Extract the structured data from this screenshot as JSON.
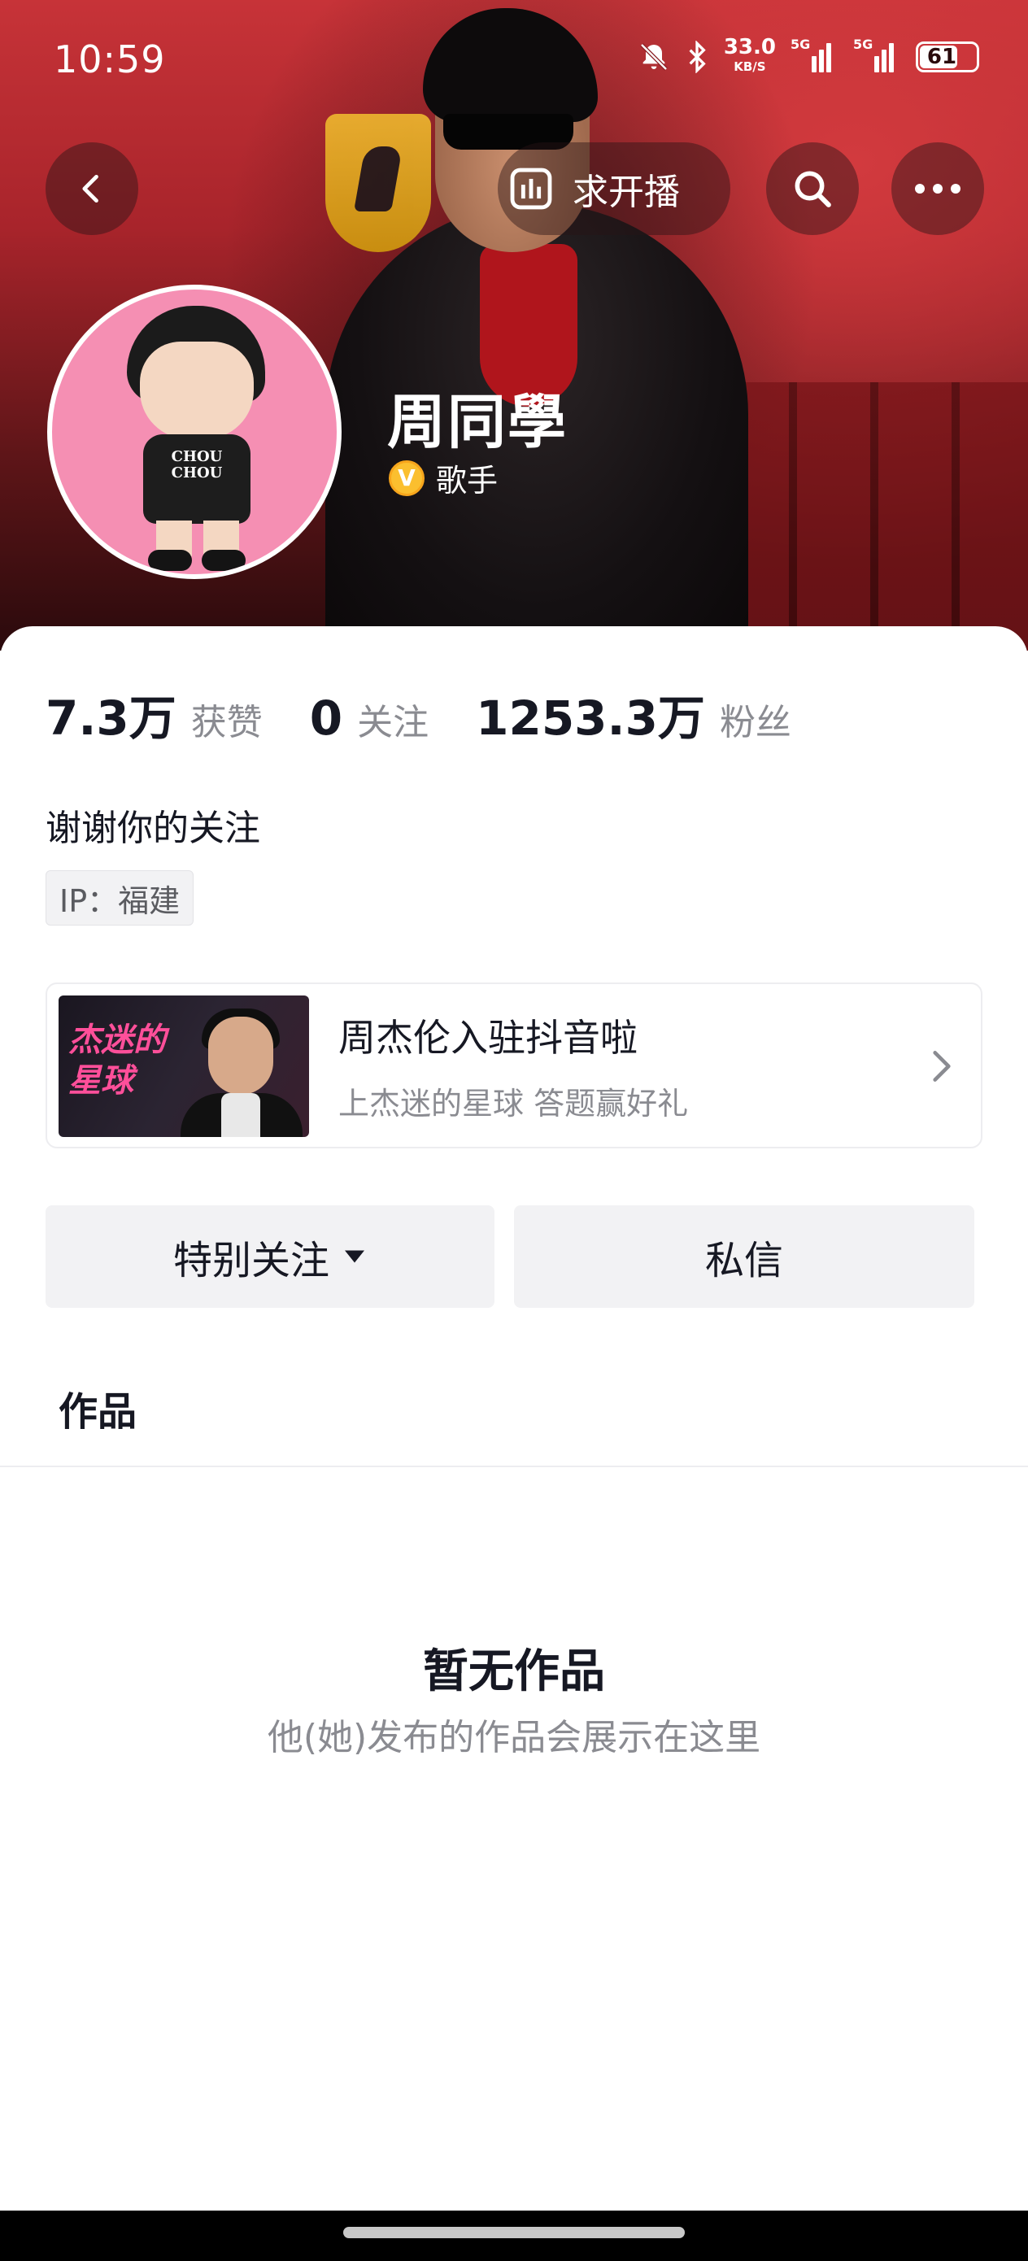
{
  "status_bar": {
    "time": "10:59",
    "speed_value": "33.0",
    "speed_unit": "KB/S",
    "network_1": "5G",
    "network_2": "5G",
    "battery": "61"
  },
  "header": {
    "live_request_label": "求开播",
    "icons": [
      "back-icon",
      "live-bars-icon",
      "search-icon",
      "more-icon"
    ]
  },
  "profile": {
    "name": "周同學",
    "role": "歌手",
    "verified_badge": "V",
    "avatar_shirt_text": "CHOU CHOU"
  },
  "stats": [
    {
      "value": "7.3万",
      "label": "获赞"
    },
    {
      "value": "0",
      "label": "关注"
    },
    {
      "value": "1253.3万",
      "label": "粉丝"
    }
  ],
  "bio": "谢谢你的关注",
  "ip_tag": "IP：福建",
  "promo": {
    "thumb_text": "杰迷的星球",
    "title": "周杰伦入驻抖音啦",
    "subtitle": "上杰迷的星球 答题赢好礼"
  },
  "actions": {
    "follow_label": "特别关注",
    "message_label": "私信"
  },
  "tabs": {
    "works_label": "作品"
  },
  "empty_state": {
    "title": "暂无作品",
    "subtitle": "他(她)发布的作品会展示在这里"
  },
  "colors": {
    "cover_red": "#c73338",
    "text_primary": "#161823",
    "text_secondary": "#8a8b91",
    "button_bg": "#f2f2f4",
    "badge_gold": "#fbbf2f",
    "avatar_pink": "#f58fb3"
  }
}
